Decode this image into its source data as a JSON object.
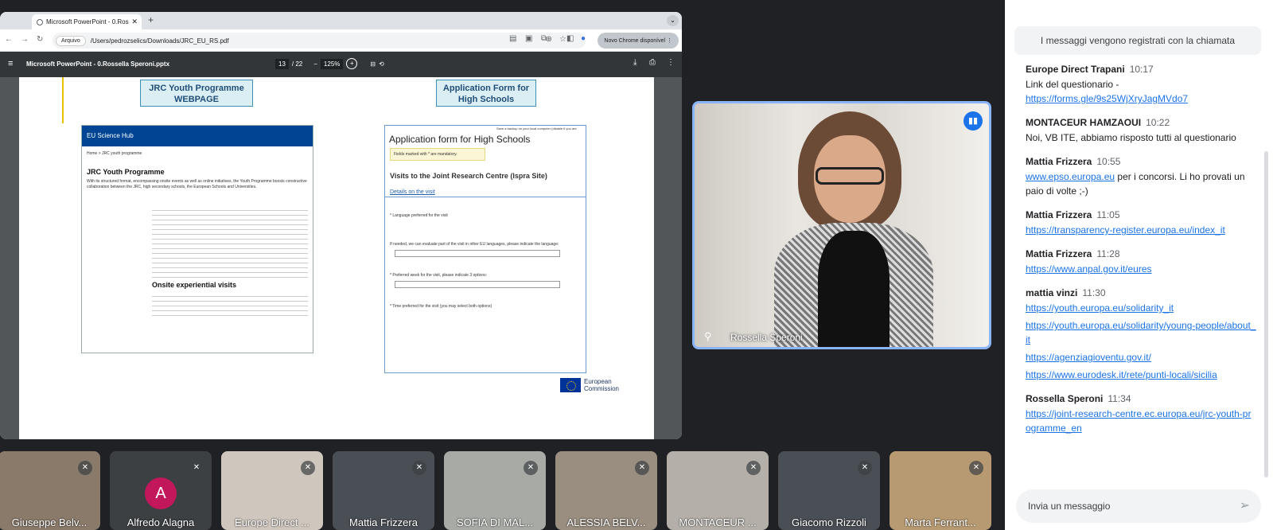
{
  "browser": {
    "tab_title": "Microsoft PowerPoint - 0.Ros",
    "url_chip": "Arquivo",
    "url": "/Users/pedrozselics/Downloads/JRC_EU_RS.pdf",
    "chrome_button": "Novo Chrome disponível"
  },
  "pdf": {
    "title": "Microsoft PowerPoint - 0.Rossella Speroni.pptx",
    "page_current": "13",
    "page_total": "/ 22",
    "zoom": "125%"
  },
  "slide": {
    "box_left": "JRC Youth Programme WEBPAGE",
    "box_right": "Application Form for High Schools",
    "web": {
      "header": "EU Science Hub",
      "crumb": "Home > JRC youth programme",
      "heading": "JRC Youth Programme",
      "intro": "With its structured format, encompassing onsite events as well as online initiatives, the Youth Programme boosts constructive collaboration between the JRC, high secondary schools, the European Schools and Universities.",
      "section": "Onsite experiential visits"
    },
    "form": {
      "checkbox_note": "Save a backup on your local computer (disable if you are",
      "title": "Application form for High Schools",
      "mandatory": "Fields marked with * are mandatory.",
      "subtitle": "Visits to the Joint Research Centre (Ispra Site)",
      "details_link": "Details on the visit",
      "q1": "* Language preferred for the visit",
      "q2": "If needed, we can evaluate part of the visit in other EU languages, please indicate the language:",
      "q3": "* Preferred week for the visit, please indicate 3 options:",
      "q4": "* Time preferred for the visit (you may select both options)"
    },
    "ec_logo": "European Commission"
  },
  "speaker": {
    "name": "Rossella Speroni"
  },
  "chat": {
    "banner": "I messaggi vengono registrati con la chiamata",
    "messages": [
      {
        "author": "Europe Direct Trapani",
        "time": "10:17",
        "text": "Link del questionario -",
        "links": [
          "https://forms.gle/9s25WjXryJagMVdo7"
        ]
      },
      {
        "author": "MONTACEUR HAMZAOUI",
        "time": "10:22",
        "text": "Noi, VB ITE, abbiamo risposto tutti al questionario",
        "links": []
      },
      {
        "author": "Mattia Frizzera",
        "time": "10:55",
        "link_inline": "www.epso.europa.eu",
        "text": " per i concorsi. Li ho provati un paio di volte ;-)",
        "links": []
      },
      {
        "author": "Mattia Frizzera",
        "time": "11:05",
        "text": "",
        "links": [
          "https://transparency-register.europa.eu/index_it"
        ]
      },
      {
        "author": "Mattia Frizzera",
        "time": "11:28",
        "text": "",
        "links": [
          "https://www.anpal.gov.it/eures"
        ]
      },
      {
        "author": "mattia vinzi",
        "time": "11:30",
        "text": "",
        "links": [
          "https://youth.europa.eu/solidarity_it",
          "https://youth.europa.eu/solidarity/young-people/about_it",
          "https://agenziagioventu.gov.it/",
          "https://www.eurodesk.it/rete/punti-locali/sicilia"
        ]
      },
      {
        "author": "Rossella Speroni",
        "time": "11:34",
        "text": "",
        "links": [
          "https://joint-research-centre.ec.europa.eu/jrc-youth-programme_en"
        ]
      }
    ],
    "input_placeholder": "Invia un messaggio"
  },
  "participants": [
    {
      "name": "Giuseppe Belv...",
      "avatar": "",
      "color": "#8a7a6a"
    },
    {
      "name": "Alfredo Alagna",
      "avatar": "A",
      "color": "#c2185b"
    },
    {
      "name": "Europe Direct ...",
      "avatar": "",
      "color": "#cfc6bd"
    },
    {
      "name": "Mattia Frizzera",
      "avatar": "",
      "color": "#4a4f55"
    },
    {
      "name": "SOFIA DI MAL...",
      "avatar": "",
      "color": "#a8aaa5"
    },
    {
      "name": "ALESSIA BELV...",
      "avatar": "",
      "color": "#9a8e80"
    },
    {
      "name": "MONTACEUR ...",
      "avatar": "",
      "color": "#b4b0a9"
    },
    {
      "name": "Giacomo Rizzoli",
      "avatar": "",
      "color": "#4a4f55"
    },
    {
      "name": "Marta Ferrant...",
      "avatar": "",
      "color": "#b79a72"
    }
  ]
}
